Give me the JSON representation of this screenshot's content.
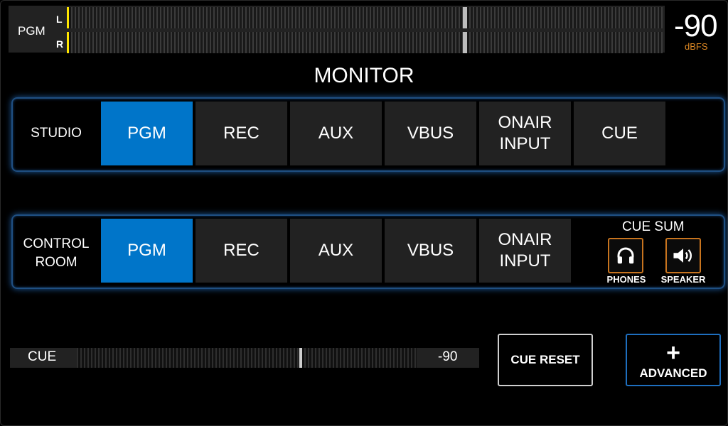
{
  "meter": {
    "source_label": "PGM",
    "channels": [
      {
        "name": "L",
        "hold_fraction": 0.665
      },
      {
        "name": "R",
        "hold_fraction": 0.665
      }
    ],
    "peak_color": "#ffe600",
    "level_value": "-90",
    "level_unit": "dBFS",
    "level_unit_color": "#e08a24"
  },
  "title": "MONITOR",
  "studio": {
    "label": "STUDIO",
    "buttons": [
      "PGM",
      "REC",
      "AUX",
      "VBUS",
      "ONAIR\nINPUT",
      "CUE"
    ],
    "selected": "PGM"
  },
  "control_room": {
    "label": "CONTROL\nROOM",
    "buttons": [
      "PGM",
      "REC",
      "AUX",
      "VBUS",
      "ONAIR\nINPUT"
    ],
    "selected": "PGM",
    "cue_sum": {
      "label": "CUE SUM",
      "phones": {
        "label": "PHONES",
        "icon": "headphones-icon"
      },
      "speaker": {
        "label": "SPEAKER",
        "icon": "speaker-icon"
      }
    }
  },
  "cue": {
    "label": "CUE",
    "value": "-90",
    "level_fraction": 0.655
  },
  "cue_reset_label": "CUE RESET",
  "advanced": {
    "icon": "+",
    "label": "ADVANCED"
  },
  "colors": {
    "accent": "#0075c9",
    "button_bg": "#222222",
    "panel_border": "#1f4f82",
    "icon_border": "#c8741e"
  }
}
